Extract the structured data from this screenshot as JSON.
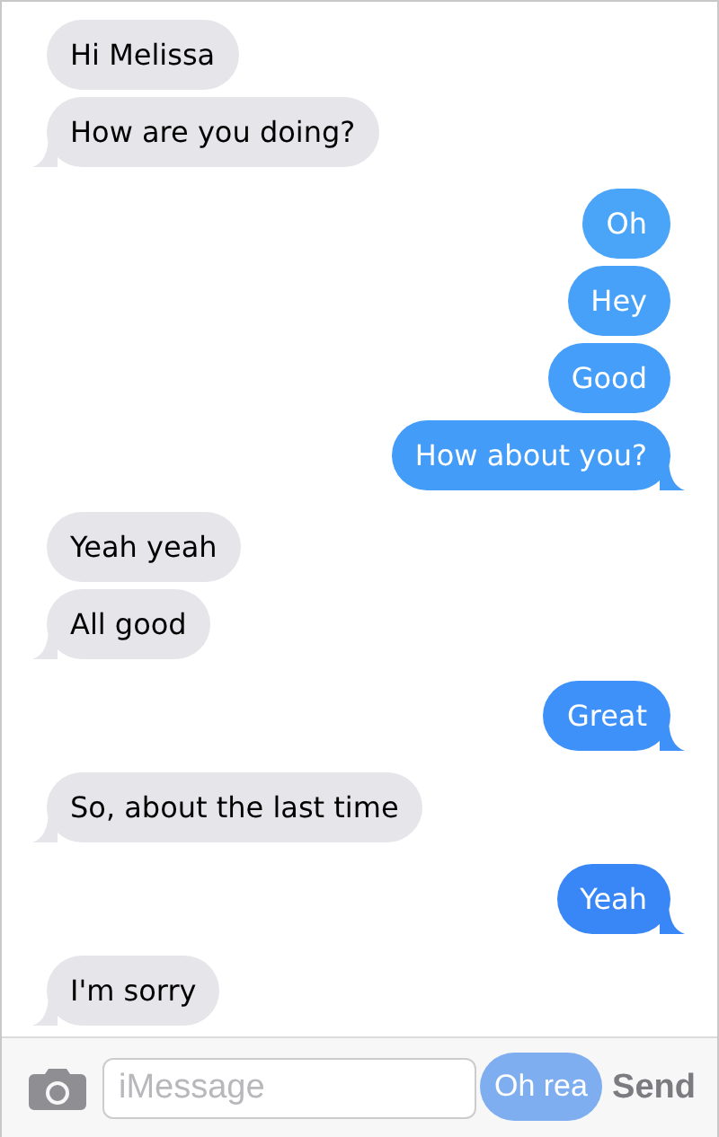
{
  "conversation": [
    {
      "kind": "received",
      "messages": [
        {
          "text": "Hi Melissa"
        },
        {
          "text": "How are you doing?"
        }
      ]
    },
    {
      "kind": "sent",
      "messages": [
        {
          "text": "Oh",
          "color": "#4aa5f9"
        },
        {
          "text": "Hey",
          "color": "#47a1f9"
        },
        {
          "text": "Good",
          "color": "#459ef9"
        },
        {
          "text": "How about you?",
          "color": "#449cf9"
        }
      ]
    },
    {
      "kind": "received",
      "messages": [
        {
          "text": "Yeah yeah"
        },
        {
          "text": "All good"
        }
      ]
    },
    {
      "kind": "sent",
      "messages": [
        {
          "text": "Great",
          "color": "#3e91f8"
        }
      ]
    },
    {
      "kind": "received",
      "messages": [
        {
          "text": "So, about the last time"
        }
      ]
    },
    {
      "kind": "sent",
      "messages": [
        {
          "text": "Yeah",
          "color": "#3987f7"
        }
      ]
    },
    {
      "kind": "received",
      "messages": [
        {
          "text": "I'm sorry"
        }
      ]
    }
  ],
  "composer": {
    "placeholder": "iMessage",
    "send": {
      "label": "Send",
      "disabled": true
    },
    "sending_bubble": {
      "text": "Oh rea"
    }
  }
}
